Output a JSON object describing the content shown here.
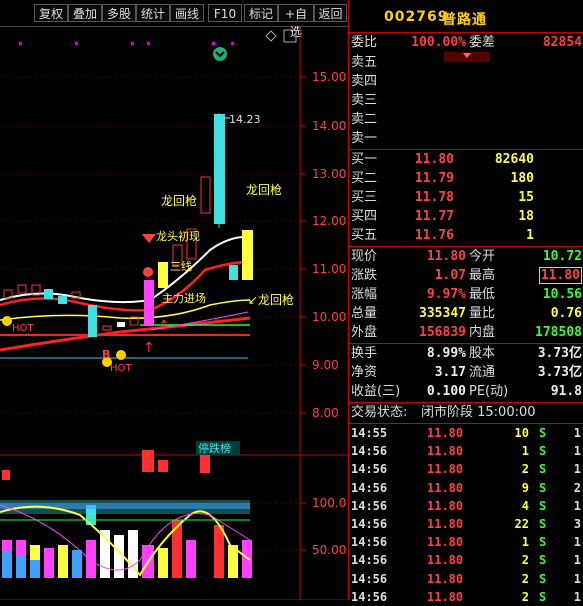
{
  "toolbar": {
    "buttons": [
      "复权",
      "叠加",
      "多股",
      "统计",
      "画线",
      "F10",
      "标记",
      "+自选",
      "返回"
    ]
  },
  "chart": {
    "price_axis": [
      "15.00",
      "14.00",
      "13.00",
      "12.00",
      "11.00",
      "10.00",
      "9.00",
      "8.00"
    ],
    "indicator_axis": [
      "100.0",
      "50.00"
    ],
    "high_label": "14.23",
    "annotations": {
      "longhui_1": "龙回枪",
      "longhui_2": "龙回枪",
      "longhui_3": "↙龙回枪",
      "longtou": "龙头初现",
      "sanxian": "三线",
      "zhuli": "主力进场",
      "hot1": "HOT",
      "hot2": "HOT",
      "b_mark": "B",
      "tingban": "停跌榜"
    }
  },
  "quote": {
    "code": "002769",
    "name": "普路通",
    "weibi_label": "委比",
    "weibi_value": "100.00%",
    "weicha_label": "委差",
    "weicha_value": "82854",
    "asks": [
      {
        "label": "卖五",
        "price": "",
        "vol": ""
      },
      {
        "label": "卖四",
        "price": "",
        "vol": ""
      },
      {
        "label": "卖三",
        "price": "",
        "vol": ""
      },
      {
        "label": "卖二",
        "price": "",
        "vol": ""
      },
      {
        "label": "卖一",
        "price": "",
        "vol": ""
      }
    ],
    "bids": [
      {
        "label": "买一",
        "price": "11.80",
        "vol": "82640"
      },
      {
        "label": "买二",
        "price": "11.79",
        "vol": "180"
      },
      {
        "label": "买三",
        "price": "11.78",
        "vol": "15"
      },
      {
        "label": "买四",
        "price": "11.77",
        "vol": "18"
      },
      {
        "label": "买五",
        "price": "11.76",
        "vol": "1"
      }
    ],
    "stats": [
      {
        "l1": "现价",
        "v1": "11.80",
        "c1": "red",
        "l2": "今开",
        "v2": "10.72",
        "c2": "grn"
      },
      {
        "l1": "涨跌",
        "v1": "1.07",
        "c1": "red",
        "l2": "最高",
        "v2": "11.80",
        "c2": "red"
      },
      {
        "l1": "涨幅",
        "v1": "9.97%",
        "c1": "red",
        "l2": "最低",
        "v2": "10.56",
        "c2": "grn"
      },
      {
        "l1": "总量",
        "v1": "335347",
        "c1": "yel",
        "l2": "量比",
        "v2": "0.76",
        "c2": "yel"
      },
      {
        "l1": "外盘",
        "v1": "156839",
        "c1": "red",
        "l2": "内盘",
        "v2": "178508",
        "c2": "grn"
      }
    ],
    "stats2": [
      {
        "l1": "换手",
        "v1": "8.99%",
        "l2": "股本",
        "v2": "3.73亿"
      },
      {
        "l1": "净资",
        "v1": "3.17",
        "l2": "流通",
        "v2": "3.73亿"
      },
      {
        "l1": "收益(三)",
        "v1": "0.100",
        "l2": "PE(动)",
        "v2": "91.8"
      }
    ],
    "status_label": "交易状态:",
    "status_value": "闭市阶段 15:00:00",
    "trades": [
      {
        "time": "14:55",
        "price": "11.80",
        "vol": "10",
        "dir": "S",
        "n": "1"
      },
      {
        "time": "14:56",
        "price": "11.80",
        "vol": "1",
        "dir": "S",
        "n": "1"
      },
      {
        "time": "14:56",
        "price": "11.80",
        "vol": "2",
        "dir": "S",
        "n": "1"
      },
      {
        "time": "14:56",
        "price": "11.80",
        "vol": "9",
        "dir": "S",
        "n": "2"
      },
      {
        "time": "14:56",
        "price": "11.80",
        "vol": "4",
        "dir": "S",
        "n": "1"
      },
      {
        "time": "14:56",
        "price": "11.80",
        "vol": "22",
        "dir": "S",
        "n": "3"
      },
      {
        "time": "14:56",
        "price": "11.80",
        "vol": "1",
        "dir": "S",
        "n": "1"
      },
      {
        "time": "14:56",
        "price": "11.80",
        "vol": "2",
        "dir": "S",
        "n": "1"
      },
      {
        "time": "14:56",
        "price": "11.80",
        "vol": "2",
        "dir": "S",
        "n": "1"
      },
      {
        "time": "14:56",
        "price": "11.80",
        "vol": "2",
        "dir": "S",
        "n": "1"
      }
    ]
  },
  "colors": {
    "up": "#ff3030",
    "down": "#40e0e0",
    "price_red": "#ff4040",
    "green": "#33ff33",
    "yellow": "#ffff40",
    "accent": "#ffd000"
  }
}
